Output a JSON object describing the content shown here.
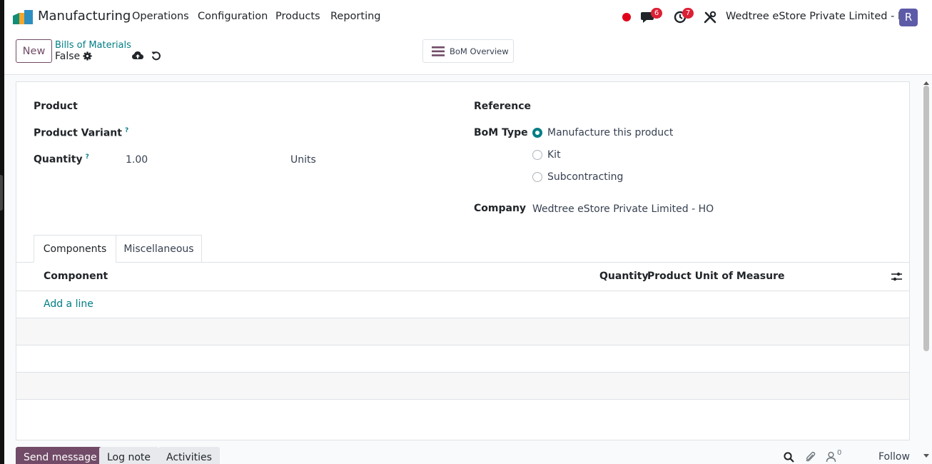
{
  "navbar": {
    "app_name": "Manufacturing",
    "menus": [
      "Operations",
      "Configuration",
      "Products",
      "Reporting"
    ],
    "messages_badge": "6",
    "activities_badge": "7",
    "company": "Wedtree eStore Private Limited - HO",
    "avatar_initial": "R"
  },
  "control_panel": {
    "new_label": "New",
    "breadcrumb_parent": "Bills of Materials",
    "breadcrumb_current": "False",
    "bom_overview_label": "BoM Overview"
  },
  "form": {
    "product_label": "Product",
    "product_variant_label": "Product Variant",
    "quantity_label": "Quantity",
    "quantity_value": "1.00",
    "uom_value": "Units",
    "help_marker": "?",
    "reference_label": "Reference",
    "bom_type_label": "BoM Type",
    "bom_type_options": [
      "Manufacture this product",
      "Kit",
      "Subcontracting"
    ],
    "company_label": "Company",
    "company_value": "Wedtree eStore Private Limited - HO"
  },
  "tabs": [
    "Components",
    "Miscellaneous"
  ],
  "table": {
    "columns": [
      "Component",
      "Quantity",
      "Product Unit of Measure"
    ],
    "add_line": "Add a line"
  },
  "chatter": {
    "send_message": "Send message",
    "log_note": "Log note",
    "activities": "Activities",
    "follower_count": "0",
    "follow": "Follow"
  },
  "colors": {
    "brand": "#714b67",
    "accent": "#017e84",
    "badge": "#dc2035",
    "avatar": "#5d5ba8"
  }
}
